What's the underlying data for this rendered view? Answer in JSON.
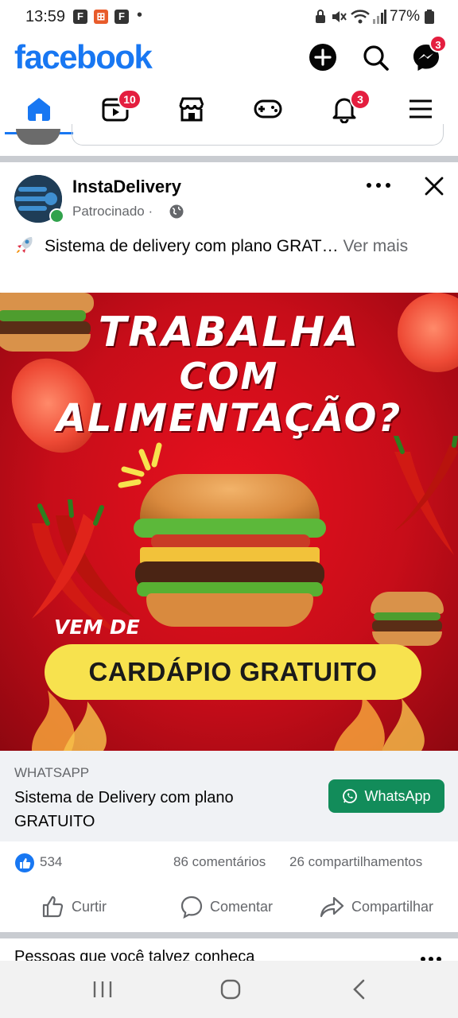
{
  "status_bar": {
    "time": "13:59",
    "notif_icons": [
      "F",
      "⊞",
      "F"
    ],
    "dot": "•",
    "battery": "77%"
  },
  "header": {
    "logo": "facebook",
    "messenger_badge": "3"
  },
  "nav": {
    "video_badge": "10",
    "notifications_badge": "3"
  },
  "post": {
    "page_name": "InstaDelivery",
    "sponsored_label": "Patrocinado ·",
    "text": "Sistema de delivery com plano GRAT…",
    "see_more": "Ver mais",
    "creative": {
      "line1": "TRABALHA",
      "line2": "COM",
      "line3": "ALIMENTAÇÃO?",
      "vem_de": "VEM DE",
      "cta": "CARDÁPIO GRATUITO"
    },
    "link": {
      "domain": "WHATSAPP",
      "title": "Sistema de Delivery com plano GRATUITO",
      "button_label": "WhatsApp"
    },
    "stats": {
      "likes": "534",
      "comments": "86 comentários",
      "shares": "26 compartilhamentos"
    },
    "actions": {
      "like": "Curtir",
      "comment": "Comentar",
      "share": "Compartilhar"
    }
  },
  "next_section": {
    "title": "Pessoas que você talvez conheça"
  },
  "colors": {
    "brand": "#1877f2",
    "badge": "#e41e3f",
    "whatsapp": "#128c5a",
    "creative_red": "#d90d1b",
    "cta_yellow": "#f7e24e"
  }
}
